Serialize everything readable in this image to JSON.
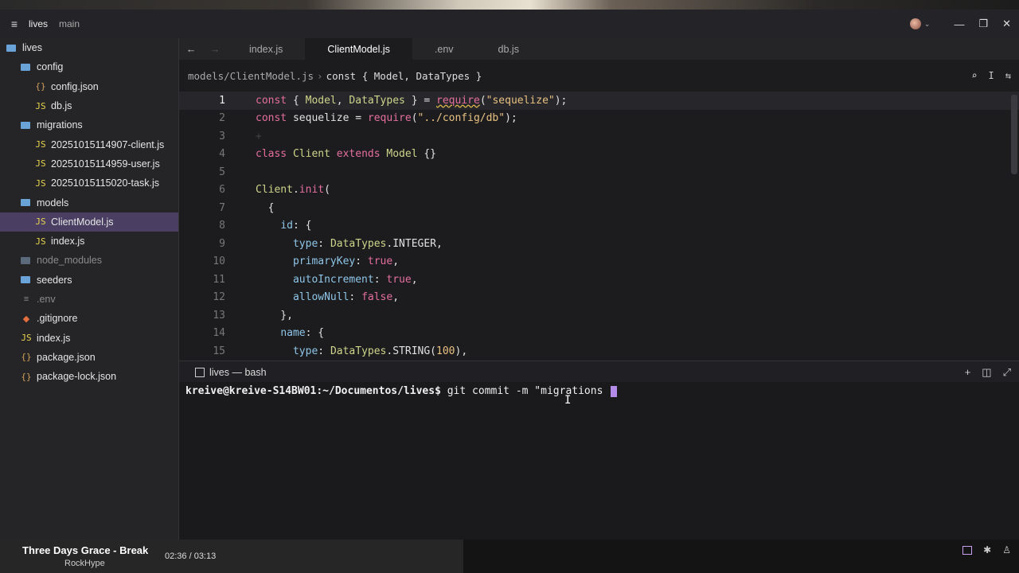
{
  "titlebar": {
    "project": "lives",
    "branch": "main"
  },
  "sidebar": {
    "items": [
      {
        "label": "lives",
        "type": "root"
      },
      {
        "label": "config",
        "type": "folder"
      },
      {
        "label": "config.json",
        "type": "json"
      },
      {
        "label": "db.js",
        "type": "js"
      },
      {
        "label": "migrations",
        "type": "folder"
      },
      {
        "label": "20251015114907-client.js",
        "type": "js"
      },
      {
        "label": "20251015114959-user.js",
        "type": "js"
      },
      {
        "label": "20251015115020-task.js",
        "type": "js"
      },
      {
        "label": "models",
        "type": "folder"
      },
      {
        "label": "ClientModel.js",
        "type": "js"
      },
      {
        "label": "index.js",
        "type": "js"
      },
      {
        "label": "node_modules",
        "type": "folder-dim"
      },
      {
        "label": "seeders",
        "type": "folder"
      },
      {
        "label": ".env",
        "type": "env"
      },
      {
        "label": ".gitignore",
        "type": "git"
      },
      {
        "label": "index.js",
        "type": "js"
      },
      {
        "label": "package.json",
        "type": "json"
      },
      {
        "label": "package-lock.json",
        "type": "json"
      }
    ]
  },
  "tabs": [
    "index.js",
    "ClientModel.js",
    ".env",
    "db.js"
  ],
  "breadcrumb": {
    "path": "models/ClientModel.js",
    "separator": "›",
    "symbol": "const { Model, DataTypes }"
  },
  "editor": {
    "line_numbers": [
      "1",
      "2",
      "3",
      "4",
      "5",
      "6",
      "7",
      "8",
      "9",
      "10",
      "11",
      "12",
      "13",
      "14",
      "15"
    ],
    "hint_glyph": "+"
  },
  "terminal": {
    "tab_label": "lives — bash",
    "prompt": "kreive@kreive-S14BW01:~/Documentos/lives$",
    "command": " git commit -m \"migrations "
  },
  "media": {
    "song": "Three Days Grace - Break",
    "artist": "RockHype",
    "time": "02:36 / 03:13"
  },
  "icons": {
    "menu": "≡",
    "back": "←",
    "forward": "→",
    "search": "⌕",
    "cursor": "I",
    "filter": "⇆",
    "add": "+",
    "split": "◫",
    "maximize": "⤢",
    "minimize": "—",
    "restore": "❐",
    "close": "✕"
  }
}
